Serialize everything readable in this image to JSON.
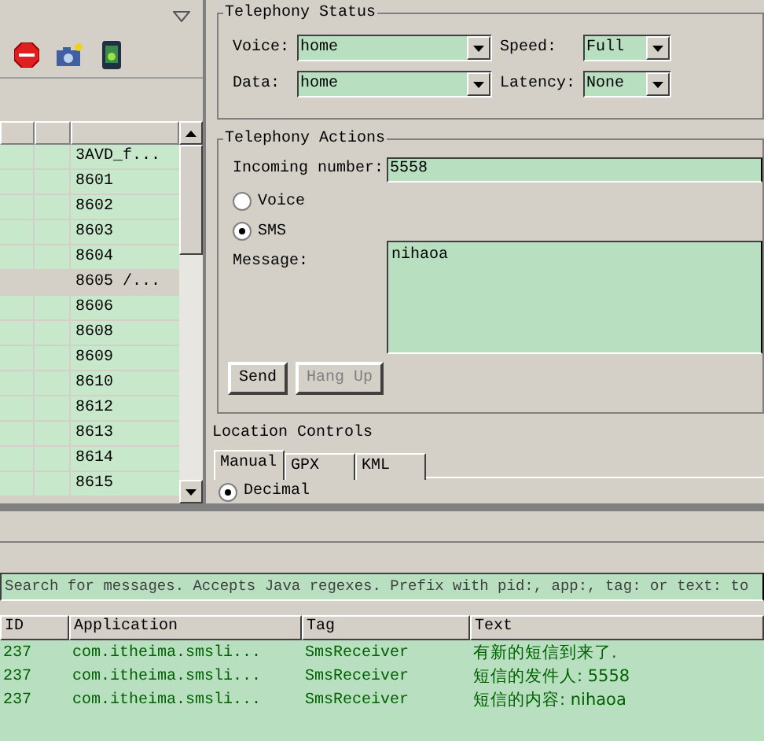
{
  "devices_table": {
    "rows": [
      {
        "column_3": "3AVD_f...",
        "selected": false
      },
      {
        "column_3": "8601",
        "selected": false
      },
      {
        "column_3": "8602",
        "selected": false
      },
      {
        "column_3": "8603",
        "selected": false
      },
      {
        "column_3": "8604",
        "selected": false
      },
      {
        "column_3": "8605 /...",
        "selected": true
      },
      {
        "column_3": "8606",
        "selected": false
      },
      {
        "column_3": "8608",
        "selected": false
      },
      {
        "column_3": "8609",
        "selected": false
      },
      {
        "column_3": "8610",
        "selected": false
      },
      {
        "column_3": "8612",
        "selected": false
      },
      {
        "column_3": "8613",
        "selected": false
      },
      {
        "column_3": "8614",
        "selected": false
      },
      {
        "column_3": "8615",
        "selected": false
      }
    ]
  },
  "telephony_status": {
    "title": "Telephony Status",
    "fields": [
      {
        "label": "Voice:",
        "value": "home"
      },
      {
        "label": "Speed:",
        "value": "Full"
      },
      {
        "label": "Data:",
        "value": "home"
      },
      {
        "label": "Latency:",
        "value": "None"
      }
    ]
  },
  "telephony_actions": {
    "title": "Telephony Actions",
    "incoming_label": "Incoming number:",
    "incoming_number": "5558",
    "radios": [
      {
        "label": "Voice",
        "selected": false
      },
      {
        "label": "SMS",
        "selected": true
      }
    ],
    "message_label": "Message:",
    "message": "nihaoa",
    "buttons": [
      {
        "label": "Send",
        "disabled": false
      },
      {
        "label": "Hang Up",
        "disabled": true
      }
    ]
  },
  "location_controls": {
    "title": "Location Controls",
    "tabs": [
      {
        "label": "Manual",
        "selected": true
      },
      {
        "label": "GPX",
        "selected": false
      },
      {
        "label": "KML",
        "selected": false
      }
    ],
    "radios": [
      {
        "label": "Decimal",
        "selected": true
      }
    ]
  },
  "logcat": {
    "search_placeholder": "Search for messages. Accepts Java regexes. Prefix with pid:, app:, tag: or text: to",
    "columns": [
      "ID",
      "Application",
      "Tag",
      "Text"
    ],
    "rows": [
      [
        "237",
        "com.itheima.smsli...",
        "SmsReceiver",
        "有新的短信到来了."
      ],
      [
        "237",
        "com.itheima.smsli...",
        "SmsReceiver",
        "短信的发件人: 5558"
      ],
      [
        "237",
        "com.itheima.smsli...",
        "SmsReceiver",
        "短信的内容: nihaoa"
      ]
    ]
  }
}
